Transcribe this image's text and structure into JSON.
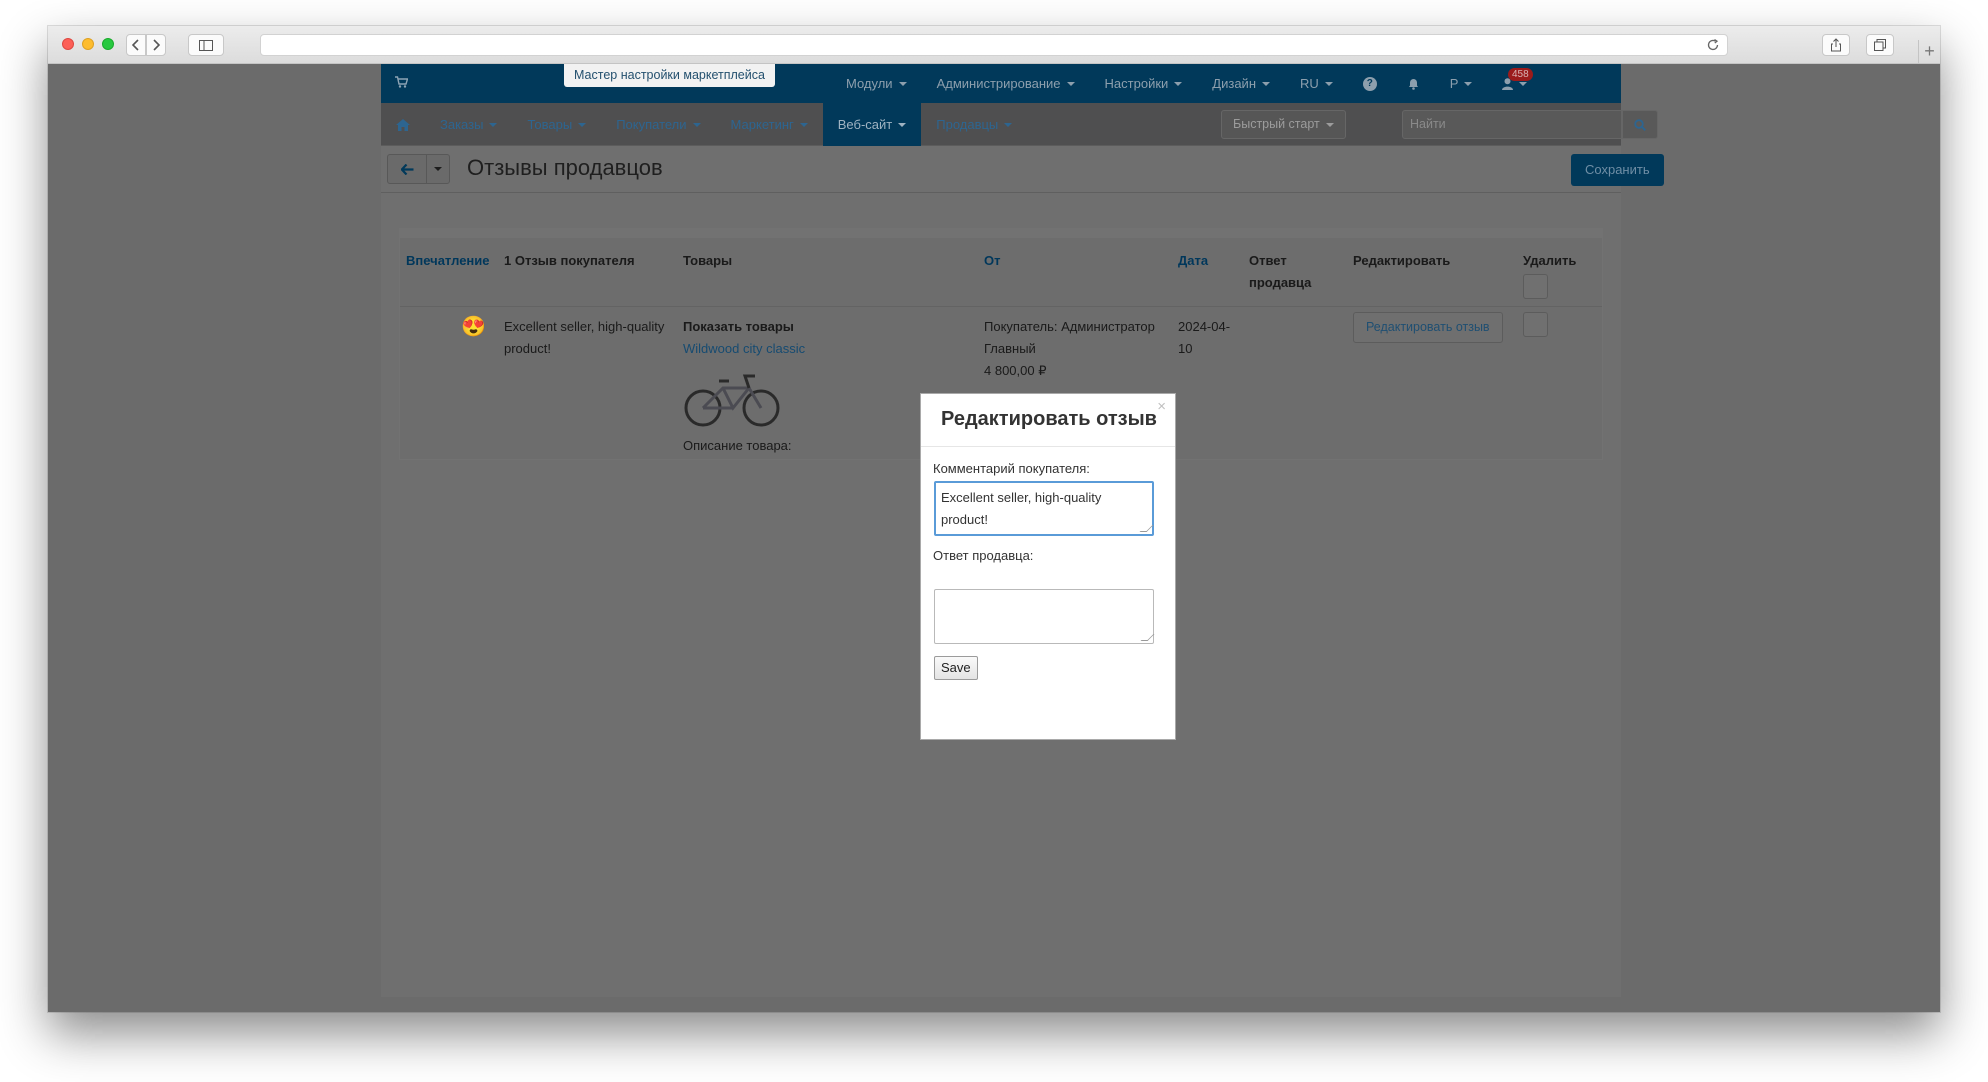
{
  "app": {
    "wizard_label": "Мастер настройки маркетплейса",
    "top_menu": [
      {
        "label": "Модули"
      },
      {
        "label": "Администрирование"
      },
      {
        "label": "Настройки"
      },
      {
        "label": "Дизайн"
      },
      {
        "label": "RU"
      }
    ],
    "notifications_count": "458",
    "currency": "Р",
    "nav": [
      {
        "label": "Заказы",
        "active": false
      },
      {
        "label": "Товары",
        "active": false
      },
      {
        "label": "Покупатели",
        "active": false
      },
      {
        "label": "Маркетинг",
        "active": false
      },
      {
        "label": "Веб-сайт",
        "active": true
      },
      {
        "label": "Продавцы",
        "active": false
      }
    ],
    "quick_start": "Быстрый старт",
    "search_placeholder": "Найти",
    "page_title": "Отзывы продавцов",
    "save_label": "Сохранить"
  },
  "table": {
    "headers": {
      "impression": "Впечатление",
      "review": "1 Отзыв покупателя",
      "products": "Товары",
      "from": "От",
      "date": "Дата",
      "reply": "Ответ продавца",
      "edit": "Редактировать",
      "delete": "Удалить"
    },
    "rows": [
      {
        "impression_emoji": "😍",
        "review": "Excellent seller, high-quality product!",
        "show_products": "Показать товары",
        "product_name": "Wildwood city classic",
        "product_description": "Описание товара:",
        "from_line1": "Покупатель: Администратор Главный",
        "from_price": "4 800,00 ₽",
        "date": "2024-04-10",
        "reply": "",
        "edit_label": "Редактировать отзыв"
      }
    ]
  },
  "modal": {
    "title": "Редактировать отзыв",
    "close": "×",
    "customer_comment_label": "Комментарий покупателя:",
    "customer_comment_value": "Excellent seller, high-quality product!",
    "seller_reply_label": "Ответ продавца:",
    "seller_reply_value": "",
    "save_label": "Save"
  },
  "icons": [
    "cart-icon",
    "help-icon",
    "bell-icon",
    "user-icon",
    "home-icon",
    "search-icon",
    "back-arrow-icon",
    "close-icon",
    "bike-image"
  ],
  "colors": {
    "brand_dark": "#01395a",
    "overlay": "#6b6b6b",
    "link": "#00375b",
    "badge": "#9b1b1b"
  }
}
